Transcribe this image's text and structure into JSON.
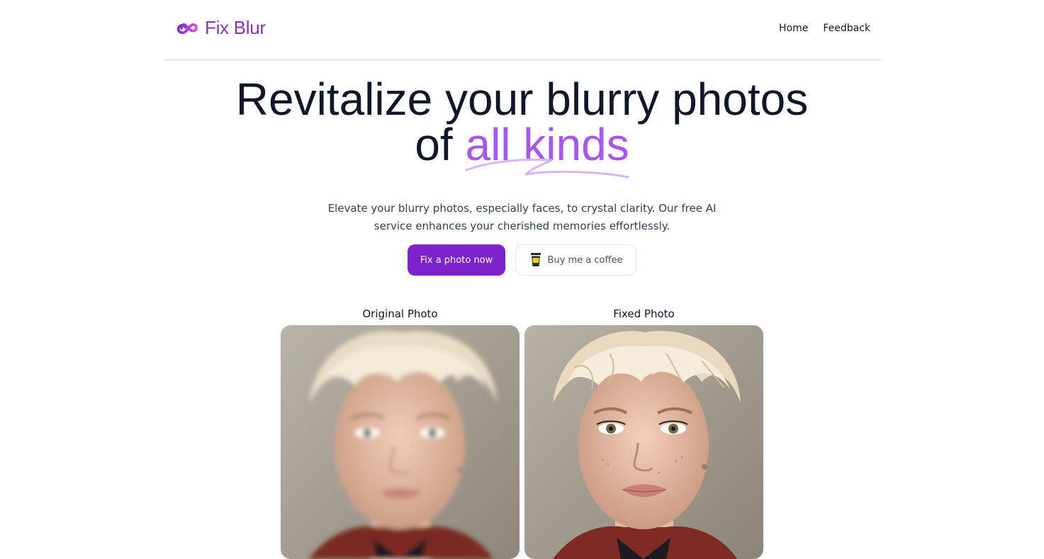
{
  "header": {
    "logo_icon": "infinity-icon",
    "logo_text": "Fix Blur",
    "nav": [
      {
        "label": "Home"
      },
      {
        "label": "Feedback"
      }
    ]
  },
  "hero": {
    "title_line1": "Revitalize your blurry photos",
    "title_line2_prefix": "of",
    "title_line2_accent": "all kinds",
    "subtitle_line1": "Elevate your blurry photos, especially faces, to crystal clarity. Our free AI",
    "subtitle_line2": "service enhances your cherished memories effortlessly."
  },
  "actions": {
    "primary_label": "Fix a photo now",
    "secondary_label": "Buy me a coffee",
    "secondary_icon": "coffee-cup-icon"
  },
  "comparison": {
    "original_label": "Original Photo",
    "fixed_label": "Fixed Photo"
  },
  "colors": {
    "brand": "#7e22ce",
    "accent": "#a855f7",
    "text": "#0f172a",
    "muted": "#334155"
  }
}
